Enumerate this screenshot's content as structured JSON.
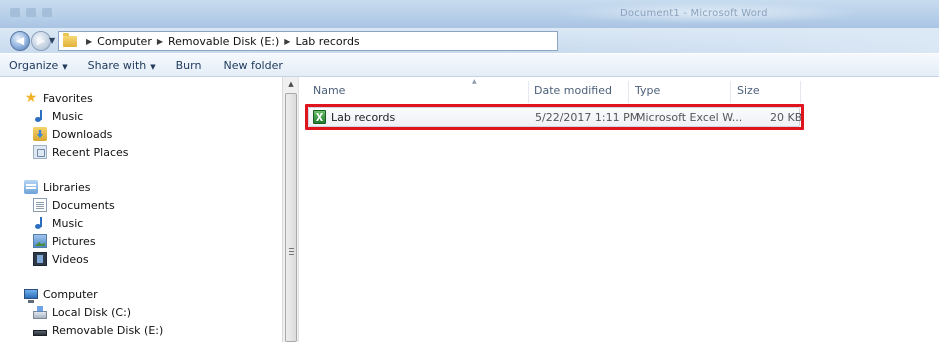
{
  "titlebar": {
    "document_title": "Document1 - Microsoft Word"
  },
  "address": {
    "breadcrumb": [
      "Computer",
      "Removable Disk (E:)",
      "Lab records"
    ]
  },
  "toolbar": {
    "organize": "Organize",
    "share_with": "Share with",
    "burn": "Burn",
    "new_folder": "New folder"
  },
  "nav": {
    "favorites": {
      "header": "Favorites",
      "items": [
        "Music",
        "Downloads",
        "Recent Places"
      ]
    },
    "libraries": {
      "header": "Libraries",
      "items": [
        "Documents",
        "Music",
        "Pictures",
        "Videos"
      ]
    },
    "computer": {
      "header": "Computer",
      "items": [
        "Local Disk (C:)",
        "Removable Disk (E:)"
      ]
    }
  },
  "files": {
    "columns": [
      "Name",
      "Date modified",
      "Type",
      "Size"
    ],
    "rows": [
      {
        "name": "Lab records",
        "date_modified": "5/22/2017 1:11 PM",
        "type": "Microsoft Excel W...",
        "size": "20 KB",
        "icon": "excel-file-icon",
        "highlighted": true
      }
    ]
  },
  "colors": {
    "highlight": "#e0141d",
    "toolbar_text": "#1e395b",
    "header_text": "#4c607a"
  }
}
